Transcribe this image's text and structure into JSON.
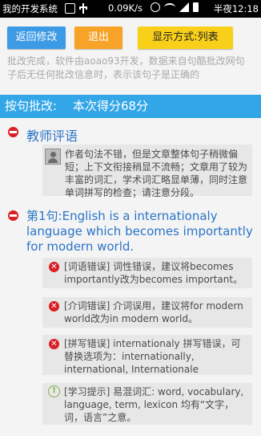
{
  "status_bar": {
    "app_name": "我的开发系统",
    "speed": "0.09K/s",
    "time": "半夜12:18"
  },
  "toolbar": {
    "back_label": "返回修改",
    "exit_label": "退出",
    "mode_label": "显示方式:列表"
  },
  "note": "批改完成，软件由aoao93开发，数据来自句酷批改网句子后无任何批改信息时，表示该句子是正确的",
  "score_bar": {
    "label": "按句批改:",
    "score": "本次得分68分"
  },
  "teacher": {
    "title": "教师评语",
    "comment": "作者句法不错，但是文章整体句子稍微偏短；上下文衔接稍显不流畅；文章用了较为丰富的词汇，学术词汇略显单薄，同时注意单词拼写的检查；请注意分段。"
  },
  "sentence": {
    "title": "第1句:English is a internationaly language which becomes importantly for modern world."
  },
  "issues": [
    {
      "icon": "error-icon",
      "text": "[词语错误] 词性错误，建议将becomes importantly改为becomes important。"
    },
    {
      "icon": "error-icon",
      "text": "[介词错误] 介词误用，建议将for modern world改为in modern world。"
    },
    {
      "icon": "error-icon",
      "text": "[拼写错误] internationaly 拼写错误，可替换选项为：internationally, international, Internationale"
    },
    {
      "icon": "tip-icon",
      "text": "[学习提示] 易混词汇: word, vocabulary, language, term, lexicon 均有“文字，词，语言”之意。"
    }
  ],
  "colors": {
    "accent_blue": "#33a6e8",
    "back_button": "#3d9ae4",
    "exit_button": "#f6a327",
    "mode_button": "#f8d019",
    "title_blue": "#2b74c8",
    "error_red": "#d92027",
    "tip_green": "#7ab24b"
  }
}
